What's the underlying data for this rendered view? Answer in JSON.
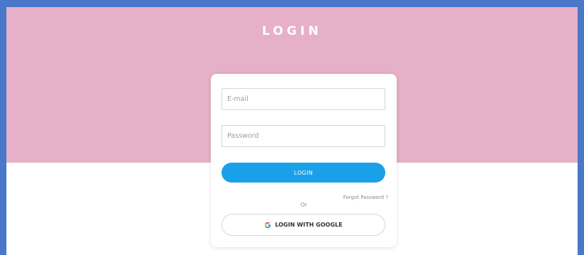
{
  "header": {
    "title": "LOGIN"
  },
  "login_form": {
    "email_placeholder": "E-mail",
    "email_value": "",
    "password_placeholder": "Password",
    "password_value": "",
    "login_button_label": "LOGIN",
    "forgot_password_label": "Forgot Password ?",
    "or_label": "Or",
    "google_button_label": "LOGIN WITH GOOGLE",
    "google_icon": "google-icon"
  },
  "colors": {
    "hero_background": "#e6b0c8",
    "login_button": "#1aa0e8",
    "window_border": "#4a78c8",
    "google_blue": "#4285F4",
    "google_red": "#EA4335",
    "google_yellow": "#FBBC05",
    "google_green": "#34A853"
  }
}
